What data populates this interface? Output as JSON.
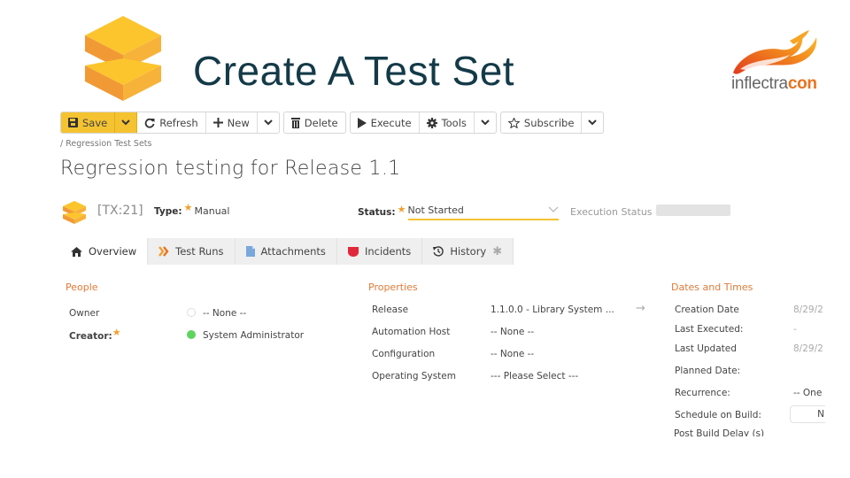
{
  "slide": {
    "title": "Create A Test Set",
    "brand": {
      "prefix": "inflectra",
      "suffix": "con"
    }
  },
  "toolbar": {
    "save": "Save",
    "refresh": "Refresh",
    "new": "New",
    "delete": "Delete",
    "execute": "Execute",
    "tools": "Tools",
    "subscribe": "Subscribe"
  },
  "breadcrumb": "/ Regression Test Sets",
  "page_title": "Regression testing for Release 1.1",
  "artifact": {
    "token": "[TX:21]",
    "type_label": "Type:",
    "type_value": "Manual",
    "status_label": "Status:",
    "status_value": "Not Started",
    "execution_status_label": "Execution Status"
  },
  "tabs": [
    {
      "label": "Overview",
      "icon": "home-icon",
      "active": true
    },
    {
      "label": "Test Runs",
      "icon": "chevrons-right-icon"
    },
    {
      "label": "Attachments",
      "icon": "document-icon"
    },
    {
      "label": "Incidents",
      "icon": "bug-icon"
    },
    {
      "label": "History",
      "icon": "history-icon"
    }
  ],
  "people": {
    "title": "People",
    "owner_label": "Owner",
    "owner_value": "-- None --",
    "creator_label": "Creator:",
    "creator_value": "System Administrator"
  },
  "properties": {
    "title": "Properties",
    "rows": [
      {
        "label": "Release",
        "value": "1.1.0.0 - Library System ..."
      },
      {
        "label": "Automation Host",
        "value": "-- None --"
      },
      {
        "label": "Configuration",
        "value": "-- None --"
      },
      {
        "label": "Operating System",
        "value": "--- Please Select ---"
      }
    ]
  },
  "dates": {
    "title": "Dates and Times",
    "rows": [
      {
        "label": "Creation Date",
        "value": "8/29/2"
      },
      {
        "label": "Last Executed:",
        "value": "-"
      },
      {
        "label": "Last Updated",
        "value": "8/29/2"
      },
      {
        "label": "Planned Date:",
        "value": ""
      },
      {
        "label": "Recurrence:",
        "value": "-- One"
      },
      {
        "label": "Schedule on Build:",
        "value": "N"
      }
    ],
    "cutoff_label": "Post Build Delay (s)"
  },
  "colors": {
    "accent": "#f5c331",
    "section_title": "#e07b39",
    "title_text": "#143a48"
  }
}
